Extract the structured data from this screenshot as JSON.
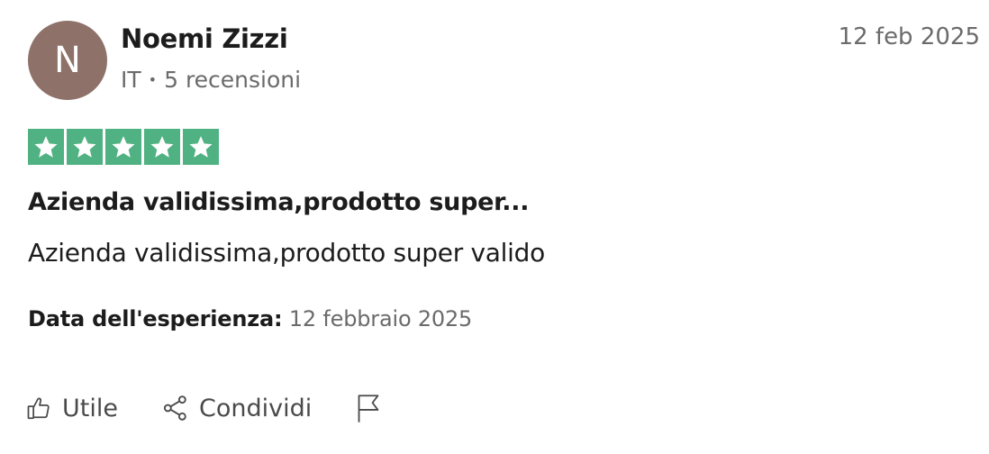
{
  "reviewer": {
    "initial": "N",
    "name": "Noemi Zizzi",
    "country": "IT",
    "separator": "•",
    "reviews_count": "5 recensioni",
    "avatar_color": "#8e7169"
  },
  "review": {
    "date": "12 feb 2025",
    "rating": 5,
    "rating_max": 5,
    "star_color": "#50b282",
    "title": "Azienda validissima,prodotto super...",
    "body": "Azienda validissima,prodotto super valido",
    "experience_label": "Data dell'esperienza:",
    "experience_date": "12 febbraio 2025"
  },
  "actions": {
    "useful_label": "Utile",
    "useful_icon": "thumbs-up-icon",
    "share_label": "Condividi",
    "share_icon": "share-icon",
    "report_icon": "flag-icon"
  }
}
